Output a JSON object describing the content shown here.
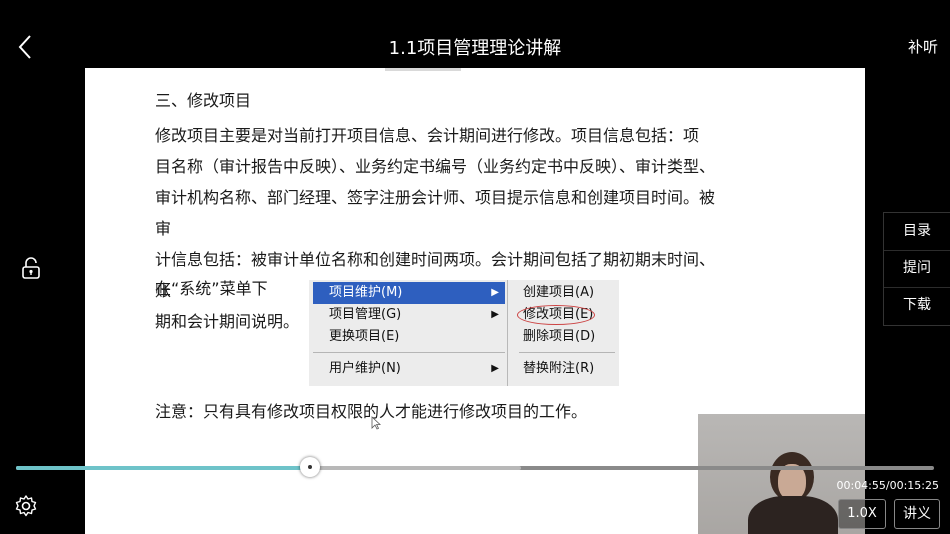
{
  "header": {
    "title": "1.1项目管理理论讲解",
    "right_label": "补听"
  },
  "slide": {
    "heading": "三、修改项目",
    "paragraph_lines": [
      "修改项目主要是对当前打开项目信息、会计期间进行修改。项目信息包括：项",
      "目名称（审计报告中反映）、业务约定书编号（业务约定书中反映）、审计类型、",
      "审计机构名称、部门经理、签字注册会计师、项目提示信息和创建项目时间。被审",
      "计信息包括：被审计单位名称和创建时间两项。会计期间包括了期初期末时间、账",
      "期和会计期间说明。"
    ],
    "system_line": "在“系统”菜单下",
    "menu_left": [
      {
        "label": "项目维护(M)",
        "selected": true,
        "arrow": "▶"
      },
      {
        "label": "项目管理(G)",
        "selected": false,
        "arrow": "▶"
      },
      {
        "label": "更换项目(E)",
        "selected": false,
        "arrow": ""
      },
      {
        "label": "用户维护(N)",
        "selected": false,
        "arrow": "▶"
      }
    ],
    "menu_right": [
      "创建项目(A)",
      "修改项目(E)",
      "删除项目(D)",
      "替换附注(R)"
    ],
    "note": "注意：只有具有修改项目权限的人才能进行修改项目的工作。"
  },
  "side_panel": {
    "items": [
      "目录",
      "提问",
      "下载"
    ]
  },
  "player": {
    "progress": 0.32,
    "buffered": 0.55,
    "time_text": "00:04:55/00:15:25",
    "speed_label": "1.0X",
    "notes_label": "讲义",
    "accent": "#6ec3c9"
  },
  "icons": {
    "back": "back-chevron-icon",
    "lock": "unlock-icon",
    "settings": "gear-icon",
    "prev": "skip-previous-icon",
    "pause": "pause-icon",
    "next": "skip-next-icon"
  }
}
